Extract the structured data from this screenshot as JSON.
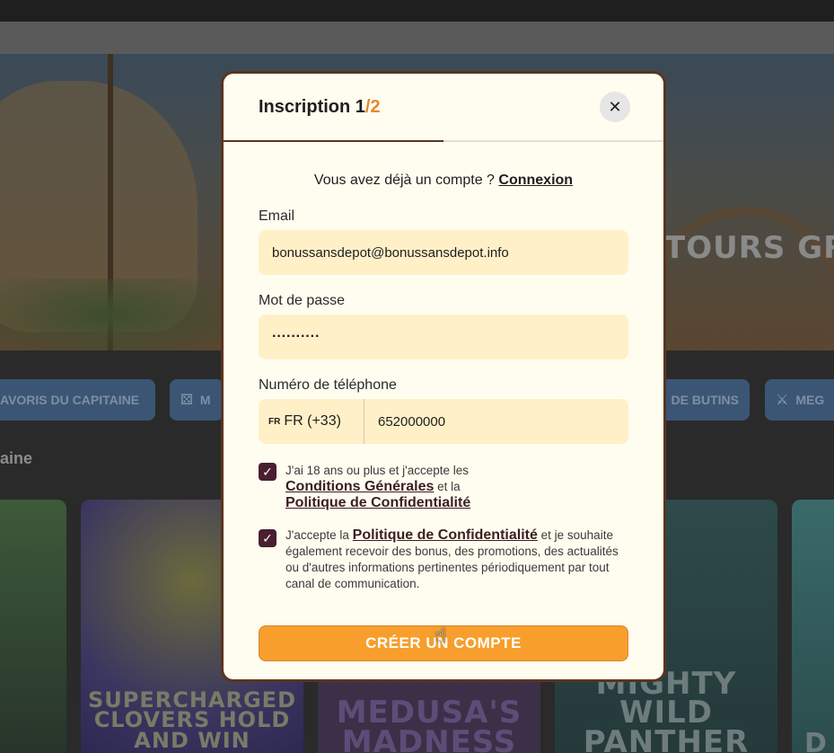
{
  "background": {
    "hero_title": "TOURS GR",
    "chips": [
      {
        "label": "AVORIS DU CAPITAINE",
        "icon": ""
      },
      {
        "label": "M",
        "icon": "dice-icon"
      },
      {
        "label": "DE BUTINS",
        "icon": ""
      },
      {
        "label": "MEG",
        "icon": "crossed-swords-icon"
      }
    ],
    "section_title": "aine",
    "games": [
      {
        "title": ""
      },
      {
        "title": "SUPERCHARGED CLOVERS HOLD AND WIN"
      },
      {
        "title": "MEDUSA'S MADNESS"
      },
      {
        "title": "MIGHTY WILD PANTHER"
      },
      {
        "title": "D"
      }
    ]
  },
  "modal": {
    "title_main": "Inscription 1",
    "title_total": "/2",
    "progress": 0.5,
    "close_glyph": "✕",
    "login_prompt": "Vous avez déjà un compte ?",
    "login_link": "Connexion",
    "email": {
      "label": "Email",
      "value": "bonussansdepot@bonussansdepot.info"
    },
    "password": {
      "label": "Mot de passe",
      "value": "··········"
    },
    "phone": {
      "label": "Numéro de téléphone",
      "flag": "FR",
      "country_code": "FR (+33)",
      "value": "652000000"
    },
    "consent1": {
      "checked": true,
      "text_before": "J'ai 18 ans ou plus et j'accepte les",
      "link1": "Conditions Générales",
      "middle": "et la",
      "link2": "Politique de Confidentialité"
    },
    "consent2": {
      "checked": true,
      "text_before": "J'accepte la",
      "link": "Politique de Confidentialité",
      "text_after": "et je souhaite également recevoir des bonus, des promotions, des actualités ou d'autres informations pertinentes périodiquement par tout canal de communication."
    },
    "submit_label": "CRÉER UN COMPTE",
    "check_glyph": "✓"
  },
  "colors": {
    "accent_orange": "#f79e2c",
    "modal_border": "#5a3520",
    "input_bg": "#fff0c8",
    "checkbox": "#4a1f30"
  }
}
